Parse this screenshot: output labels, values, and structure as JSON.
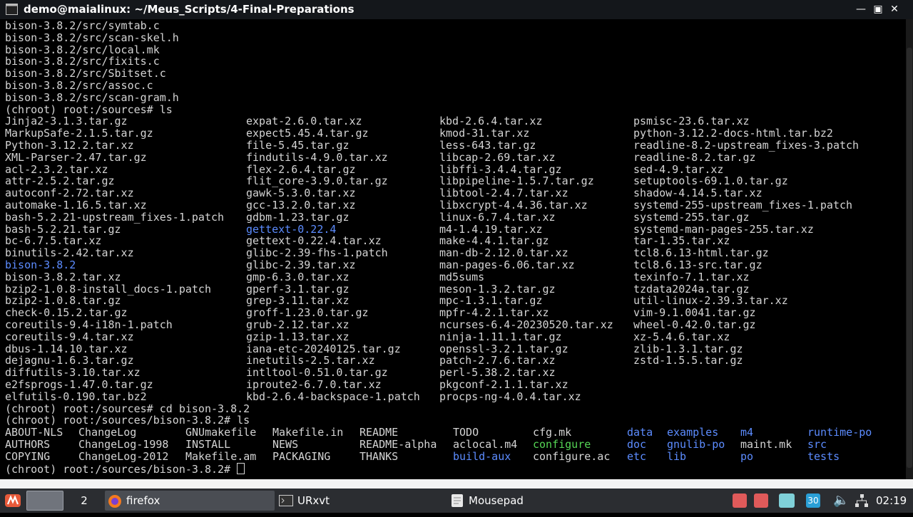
{
  "window": {
    "title": "demo@maialinux: ~/Meus_Scripts/4-Final-Preparations"
  },
  "terminal": {
    "lines": [
      "bison-3.8.2/src/symtab.c",
      "bison-3.8.2/src/scan-skel.h",
      "bison-3.8.2/src/local.mk",
      "bison-3.8.2/src/fixits.c",
      "bison-3.8.2/src/Sbitset.c",
      "bison-3.8.2/src/assoc.c",
      "bison-3.8.2/src/scan-gram.h",
      "(chroot) root:/sources# ls"
    ],
    "ls_sources": [
      [
        "Jinja2-3.1.3.tar.gz",
        "expat-2.6.0.tar.xz",
        "kbd-2.6.4.tar.xz",
        "psmisc-23.6.tar.xz"
      ],
      [
        "MarkupSafe-2.1.5.tar.gz",
        "expect5.45.4.tar.gz",
        "kmod-31.tar.xz",
        "python-3.12.2-docs-html.tar.bz2"
      ],
      [
        "Python-3.12.2.tar.xz",
        "file-5.45.tar.gz",
        "less-643.tar.gz",
        "readline-8.2-upstream_fixes-3.patch"
      ],
      [
        "XML-Parser-2.47.tar.gz",
        "findutils-4.9.0.tar.xz",
        "libcap-2.69.tar.xz",
        "readline-8.2.tar.gz"
      ],
      [
        "acl-2.3.2.tar.xz",
        "flex-2.6.4.tar.gz",
        "libffi-3.4.4.tar.gz",
        "sed-4.9.tar.xz"
      ],
      [
        "attr-2.5.2.tar.gz",
        "flit_core-3.9.0.tar.gz",
        "libpipeline-1.5.7.tar.gz",
        "setuptools-69.1.0.tar.gz"
      ],
      [
        "autoconf-2.72.tar.xz",
        "gawk-5.3.0.tar.xz",
        "libtool-2.4.7.tar.xz",
        "shadow-4.14.5.tar.xz"
      ],
      [
        "automake-1.16.5.tar.xz",
        "gcc-13.2.0.tar.xz",
        "libxcrypt-4.4.36.tar.xz",
        "systemd-255-upstream_fixes-1.patch"
      ],
      [
        "bash-5.2.21-upstream_fixes-1.patch",
        "gdbm-1.23.tar.gz",
        "linux-6.7.4.tar.xz",
        "systemd-255.tar.gz"
      ],
      [
        "bash-5.2.21.tar.gz",
        "gettext-0.22.4",
        "m4-1.4.19.tar.xz",
        "systemd-man-pages-255.tar.xz"
      ],
      [
        "bc-6.7.5.tar.xz",
        "gettext-0.22.4.tar.xz",
        "make-4.4.1.tar.gz",
        "tar-1.35.tar.xz"
      ],
      [
        "binutils-2.42.tar.xz",
        "glibc-2.39-fhs-1.patch",
        "man-db-2.12.0.tar.xz",
        "tcl8.6.13-html.tar.gz"
      ],
      [
        "bison-3.8.2",
        "glibc-2.39.tar.xz",
        "man-pages-6.06.tar.xz",
        "tcl8.6.13-src.tar.gz"
      ],
      [
        "bison-3.8.2.tar.xz",
        "gmp-6.3.0.tar.xz",
        "md5sums",
        "texinfo-7.1.tar.xz"
      ],
      [
        "bzip2-1.0.8-install_docs-1.patch",
        "gperf-3.1.tar.gz",
        "meson-1.3.2.tar.gz",
        "tzdata2024a.tar.gz"
      ],
      [
        "bzip2-1.0.8.tar.gz",
        "grep-3.11.tar.xz",
        "mpc-1.3.1.tar.gz",
        "util-linux-2.39.3.tar.xz"
      ],
      [
        "check-0.15.2.tar.gz",
        "groff-1.23.0.tar.gz",
        "mpfr-4.2.1.tar.xz",
        "vim-9.1.0041.tar.gz"
      ],
      [
        "coreutils-9.4-i18n-1.patch",
        "grub-2.12.tar.xz",
        "ncurses-6.4-20230520.tar.xz",
        "wheel-0.42.0.tar.gz"
      ],
      [
        "coreutils-9.4.tar.xz",
        "gzip-1.13.tar.xz",
        "ninja-1.11.1.tar.gz",
        "xz-5.4.6.tar.xz"
      ],
      [
        "dbus-1.14.10.tar.xz",
        "iana-etc-20240125.tar.gz",
        "openssl-3.2.1.tar.gz",
        "zlib-1.3.1.tar.gz"
      ],
      [
        "dejagnu-1.6.3.tar.gz",
        "inetutils-2.5.tar.xz",
        "patch-2.7.6.tar.xz",
        "zstd-1.5.5.tar.gz"
      ],
      [
        "diffutils-3.10.tar.xz",
        "intltool-0.51.0.tar.gz",
        "perl-5.38.2.tar.xz",
        ""
      ],
      [
        "e2fsprogs-1.47.0.tar.gz",
        "iproute2-6.7.0.tar.xz",
        "pkgconf-2.1.1.tar.xz",
        ""
      ],
      [
        "elfutils-0.190.tar.bz2",
        "kbd-2.6.4-backspace-1.patch",
        "procps-ng-4.0.4.tar.xz",
        ""
      ]
    ],
    "cmd_cd": "(chroot) root:/sources# cd bison-3.8.2",
    "cmd_ls": "(chroot) root:/sources/bison-3.8.2# ls",
    "ls_bison": [
      [
        "ABOUT-NLS",
        "ChangeLog",
        "GNUmakefile",
        "Makefile.in",
        "README",
        "TODO",
        "cfg.mk",
        "data",
        "examples",
        "m4",
        "runtime-po"
      ],
      [
        "AUTHORS",
        "ChangeLog-1998",
        "INSTALL",
        "NEWS",
        "README-alpha",
        "aclocal.m4",
        "configure",
        "doc",
        "gnulib-po",
        "maint.mk",
        "src"
      ],
      [
        "COPYING",
        "ChangeLog-2012",
        "Makefile.am",
        "PACKAGING",
        "THANKS",
        "build-aux",
        "configure.ac",
        "etc",
        "lib",
        "po",
        "tests"
      ]
    ],
    "prompt": "(chroot) root:/sources/bison-3.8.2# "
  },
  "taskbar": {
    "workspace_2": "2",
    "tasks": [
      {
        "label": "firefox",
        "icon": "firefox-icon"
      },
      {
        "label": "URxvt",
        "icon": "terminal-icon"
      },
      {
        "label": "Mousepad",
        "icon": "text-editor-icon"
      }
    ],
    "tray_badge": "30",
    "clock": "02:19"
  }
}
